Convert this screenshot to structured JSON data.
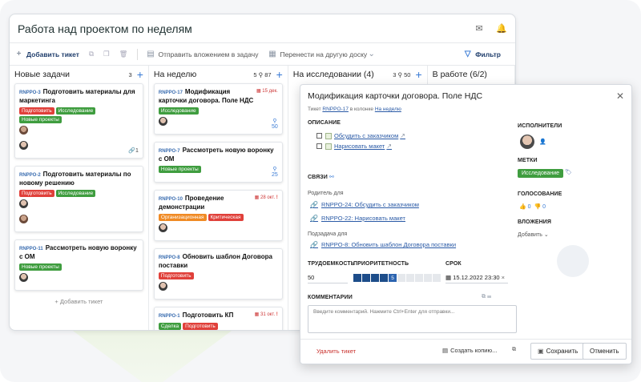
{
  "board": {
    "title": "Работа над проектом по неделям",
    "toolbar": {
      "add_ticket": "Добавить тикет",
      "send_attachment": "Отправить вложением в задачу",
      "move_board": "Перенести на другую доску",
      "filter": "Фильтр"
    }
  },
  "columns": [
    {
      "name": "Новые задачи",
      "count": "3",
      "cards": [
        {
          "key": "RNPPO-3",
          "title": "Подготовить материалы для маркетинга",
          "tags": [
            {
              "label": "Подготовить",
              "color": "#e0403a"
            },
            {
              "label": "Исследование",
              "color": "#3f9d3f"
            },
            {
              "label": "Новые проекты",
              "color": "#3f9d3f"
            }
          ],
          "meta": "1"
        },
        {
          "key": "RNPPO-2",
          "title": "Подготовить материалы по новому решению",
          "tags": [
            {
              "label": "Подготовить",
              "color": "#e0403a"
            },
            {
              "label": "Исследование",
              "color": "#3f9d3f"
            }
          ]
        },
        {
          "key": "RNPPO-11",
          "title": "Рассмотреть новую воронку с ОМ",
          "tags": [
            {
              "label": "Новые проекты",
              "color": "#3f9d3f"
            }
          ]
        }
      ],
      "add_label": "Добавить тикет"
    },
    {
      "name": "На неделю",
      "count": "5",
      "extra": "87",
      "cards": [
        {
          "key": "RNPPO-17",
          "title": "Модификация карточки договора. Поле НДС",
          "date": "15 дек.",
          "tags": [
            {
              "label": "Исследование",
              "color": "#3f9d3f"
            }
          ],
          "meta": "50"
        },
        {
          "key": "RNPPO-7",
          "title": "Рассмотреть новую воронку с ОМ",
          "tags": [
            {
              "label": "Новые проекты",
              "color": "#3f9d3f"
            }
          ],
          "meta": "25"
        },
        {
          "key": "RNPPO-10",
          "title": "Проведение демонстрации",
          "date": "28 окт.",
          "tags": [
            {
              "label": "Организационная",
              "color": "#f08a24"
            },
            {
              "label": "Критическая",
              "color": "#e0403a"
            }
          ]
        },
        {
          "key": "RNPPO-8",
          "title": "Обновить шаблон Договора поставки",
          "tags": [
            {
              "label": "Подготовить",
              "color": "#e0403a"
            }
          ]
        },
        {
          "key": "RNPPO-1",
          "title": "Подготовить КП",
          "date": "31 окт.",
          "tags": [
            {
              "label": "Сделка",
              "color": "#3f9d3f"
            },
            {
              "label": "Подготовить",
              "color": "#e0403a"
            }
          ]
        }
      ]
    },
    {
      "name": "На исследовании (4)",
      "count": "3",
      "extra": "50"
    },
    {
      "name": "В работе (6/2)"
    }
  ],
  "modal": {
    "title": "Модификация карточки договора. Поле НДС",
    "sub_prefix": "Тикет",
    "sub_key": "RNPPO-17",
    "sub_mid": "в колонке",
    "sub_col": "На неделю",
    "description_label": "ОПИСАНИЕ",
    "checklist": [
      "Обсудить с заказчиком",
      "Нарисовать макет"
    ],
    "links_label": "СВЯЗИ",
    "parent_label": "Родитель для",
    "parent_items": [
      "RNPPO-24: Обсудить с заказчиком",
      "RNPPO-22: Нарисовать макет"
    ],
    "subtask_label": "Подзадача для",
    "subtask_items": [
      "RNPPO-8: Обновить шаблон Договора поставки"
    ],
    "effort_label": "ТРУДОЕМКОСТЬ",
    "effort_value": "50",
    "priority_label": "ПРИОРИТЕТНОСТЬ",
    "priority_value": "5",
    "due_label": "СРОК",
    "due_value": "15.12.2022 23:30",
    "comments_label": "КОММЕНТАРИИ",
    "comment_placeholder": "Введите комментарий. Нажмите Ctrl+Enter для отправки...",
    "assignees_label": "ИСПОЛНИТЕЛИ",
    "tags_label": "МЕТКИ",
    "tag": "Исследование",
    "vote_label": "ГОЛОСОВАНИЕ",
    "vote_up": "0",
    "vote_down": "0",
    "attachments_label": "ВЛОЖЕНИЯ",
    "attachments_add": "Добавить",
    "delete": "Удалить тикет",
    "copy": "Создать копию...",
    "save": "Сохранить",
    "cancel": "Отменить"
  }
}
